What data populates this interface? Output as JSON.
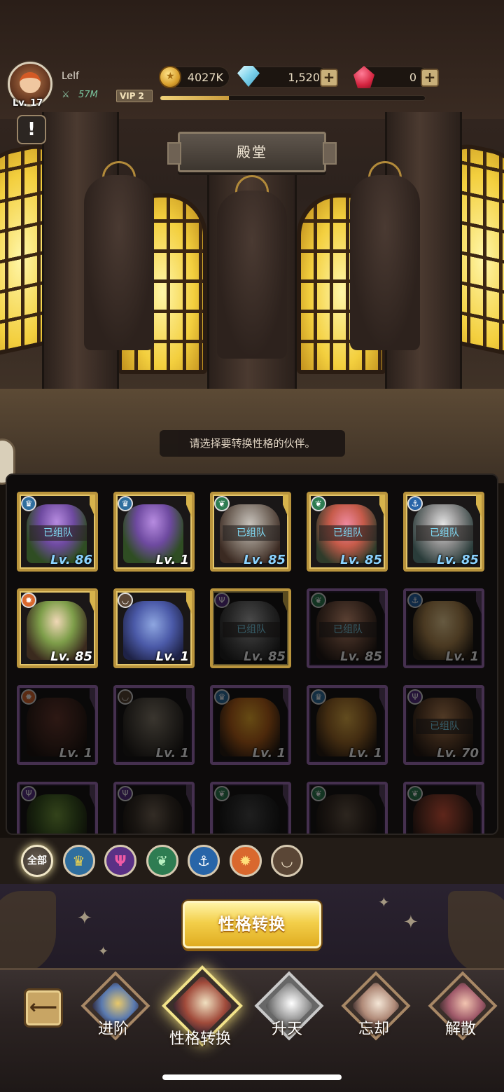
{
  "player": {
    "name": "Lelf",
    "level": "Lv. 17",
    "power": "57M",
    "vip_label": "VIP",
    "vip_level": "2",
    "xp_fraction": 0.26
  },
  "currencies": {
    "gold": "4027K",
    "diamonds": "1,520",
    "rubies": "0"
  },
  "scene": {
    "title": "殿堂",
    "hint": "请选择要转换性格的伙伴。"
  },
  "colors": {
    "gold_frame": "#b9943d",
    "purple_frame": "#45304f",
    "team_text": "#7fd8f2",
    "action_button": "#f3cf4a"
  },
  "partners": [
    {
      "faction": "crown",
      "team": "已组队",
      "level": "Lv. 86",
      "frame": "gold",
      "dim": false
    },
    {
      "faction": "crown",
      "team": "",
      "level": "Lv. 1",
      "frame": "gold",
      "dim": false
    },
    {
      "faction": "tree",
      "team": "已组队",
      "level": "Lv. 85",
      "frame": "gold",
      "dim": false
    },
    {
      "faction": "tree",
      "team": "已组队",
      "level": "Lv. 85",
      "frame": "gold",
      "dim": false
    },
    {
      "faction": "anchor",
      "team": "已组队",
      "level": "Lv. 85",
      "frame": "gold",
      "dim": false
    },
    {
      "faction": "dragon",
      "team": "",
      "level": "Lv. 85",
      "frame": "gold",
      "dim": false
    },
    {
      "faction": "moon",
      "team": "",
      "level": "Lv. 1",
      "frame": "gold",
      "dim": false
    },
    {
      "faction": "trident",
      "team": "已组队",
      "level": "Lv. 85",
      "frame": "gold",
      "dim": true
    },
    {
      "faction": "tree",
      "team": "已组队",
      "level": "Lv. 85",
      "frame": "purple",
      "dim": true
    },
    {
      "faction": "anchor",
      "team": "",
      "level": "Lv. 1",
      "frame": "purple",
      "dim": true
    },
    {
      "faction": "dragon",
      "team": "",
      "level": "Lv. 1",
      "frame": "purple",
      "dim": true
    },
    {
      "faction": "moon",
      "team": "",
      "level": "Lv. 1",
      "frame": "purple",
      "dim": true
    },
    {
      "faction": "crown",
      "team": "",
      "level": "Lv. 1",
      "frame": "purple",
      "dim": true
    },
    {
      "faction": "crown",
      "team": "",
      "level": "Lv. 1",
      "frame": "purple",
      "dim": true
    },
    {
      "faction": "trident",
      "team": "已组队",
      "level": "Lv. 70",
      "frame": "purple",
      "dim": true
    },
    {
      "faction": "trident",
      "team": "",
      "level": "",
      "frame": "purple",
      "dim": true
    },
    {
      "faction": "trident",
      "team": "",
      "level": "",
      "frame": "purple",
      "dim": true
    },
    {
      "faction": "tree",
      "team": "",
      "level": "",
      "frame": "purple",
      "dim": true
    },
    {
      "faction": "tree",
      "team": "",
      "level": "",
      "frame": "purple",
      "dim": true
    },
    {
      "faction": "tree",
      "team": "",
      "level": "",
      "frame": "purple",
      "dim": true
    }
  ],
  "filters": [
    {
      "id": "all",
      "label": "全部",
      "icon": "all-icon"
    },
    {
      "id": "crown",
      "label": "",
      "icon": "crown-icon"
    },
    {
      "id": "trident",
      "label": "",
      "icon": "trident-icon"
    },
    {
      "id": "tree",
      "label": "",
      "icon": "tree-icon"
    },
    {
      "id": "anchor",
      "label": "",
      "icon": "anchor-icon"
    },
    {
      "id": "dragon",
      "label": "",
      "icon": "dragon-icon"
    },
    {
      "id": "moon",
      "label": "",
      "icon": "moon-icon"
    }
  ],
  "action_button": "性格转换",
  "nav": {
    "items": [
      {
        "label": "进阶",
        "active": false,
        "locked": false
      },
      {
        "label": "性格转换",
        "active": true,
        "locked": false
      },
      {
        "label": "升天",
        "active": false,
        "locked": true
      },
      {
        "label": "忘却",
        "active": false,
        "locked": false
      },
      {
        "label": "解散",
        "active": false,
        "locked": false
      }
    ]
  }
}
